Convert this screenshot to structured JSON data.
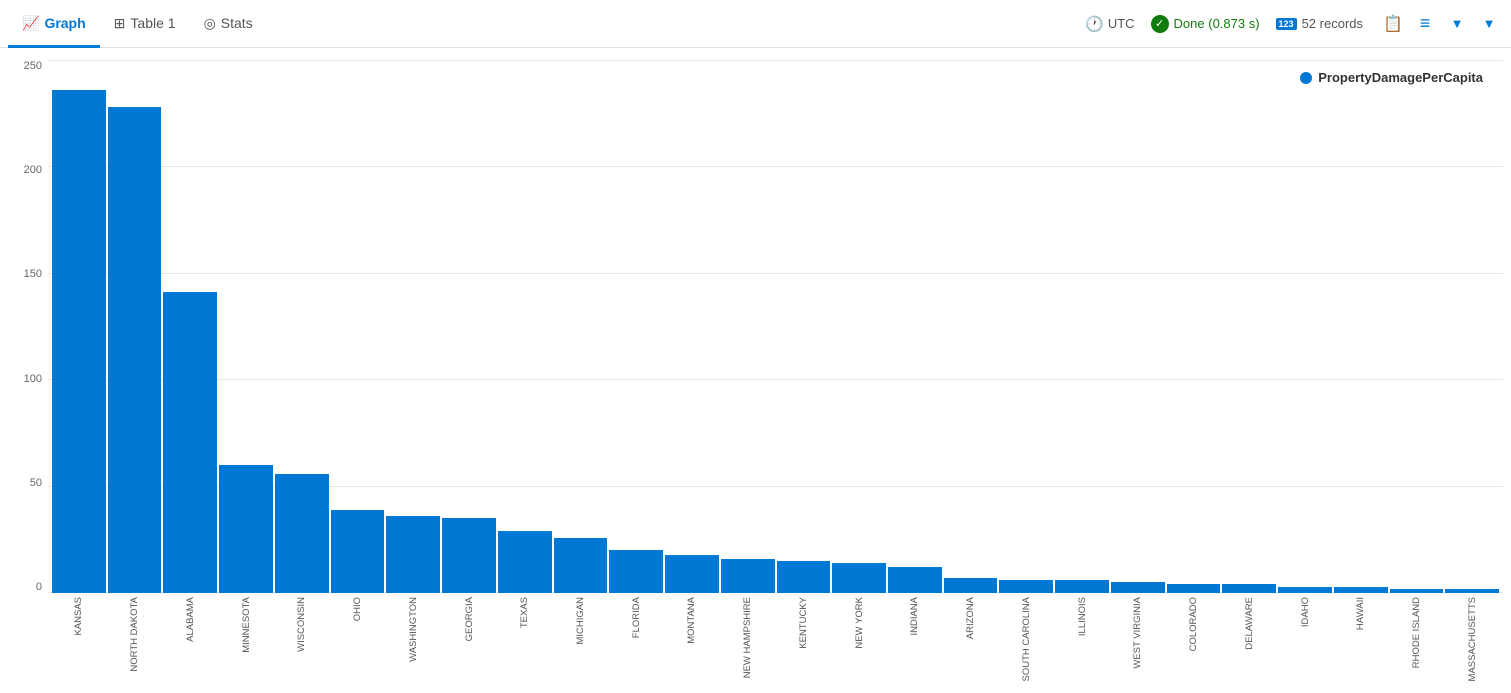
{
  "tabs": [
    {
      "id": "graph",
      "label": "Graph",
      "icon": "📈",
      "active": true
    },
    {
      "id": "table",
      "label": "Table 1",
      "icon": "⊞",
      "active": false
    },
    {
      "id": "stats",
      "label": "Stats",
      "icon": "◎",
      "active": false
    }
  ],
  "header": {
    "utc_label": "UTC",
    "done_label": "Done (0.873 s)",
    "records_label": "52 records",
    "records_icon": "123"
  },
  "legend": {
    "label": "PropertyDamagePerCapita"
  },
  "y_axis": {
    "labels": [
      "0",
      "50",
      "100",
      "150",
      "200",
      "250"
    ],
    "max": 250
  },
  "bars": [
    {
      "state": "KANSAS",
      "value": 236
    },
    {
      "state": "NORTH DAKOTA",
      "value": 228
    },
    {
      "state": "ALABAMA",
      "value": 141
    },
    {
      "state": "MINNESOTA",
      "value": 60
    },
    {
      "state": "WISCONSIN",
      "value": 56
    },
    {
      "state": "OHIO",
      "value": 39
    },
    {
      "state": "WASHINGTON",
      "value": 36
    },
    {
      "state": "GEORGIA",
      "value": 35
    },
    {
      "state": "TEXAS",
      "value": 29
    },
    {
      "state": "MICHIGAN",
      "value": 26
    },
    {
      "state": "FLORIDA",
      "value": 20
    },
    {
      "state": "MONTANA",
      "value": 18
    },
    {
      "state": "NEW HAMPSHIRE",
      "value": 16
    },
    {
      "state": "KENTUCKY",
      "value": 15
    },
    {
      "state": "NEW YORK",
      "value": 14
    },
    {
      "state": "INDIANA",
      "value": 12
    },
    {
      "state": "ARIZONA",
      "value": 7
    },
    {
      "state": "SOUTH CAROLINA",
      "value": 6
    },
    {
      "state": "ILLINOIS",
      "value": 6
    },
    {
      "state": "WEST VIRGINIA",
      "value": 5
    },
    {
      "state": "COLORADO",
      "value": 4
    },
    {
      "state": "DELAWARE",
      "value": 4
    },
    {
      "state": "IDAHO",
      "value": 3
    },
    {
      "state": "HAWAII",
      "value": 3
    },
    {
      "state": "RHODE ISLAND",
      "value": 2
    },
    {
      "state": "MASSACHUSETTS",
      "value": 2
    }
  ],
  "colors": {
    "accent": "#0078d4",
    "done_green": "#107c10",
    "bar_blue": "#0078d4"
  }
}
